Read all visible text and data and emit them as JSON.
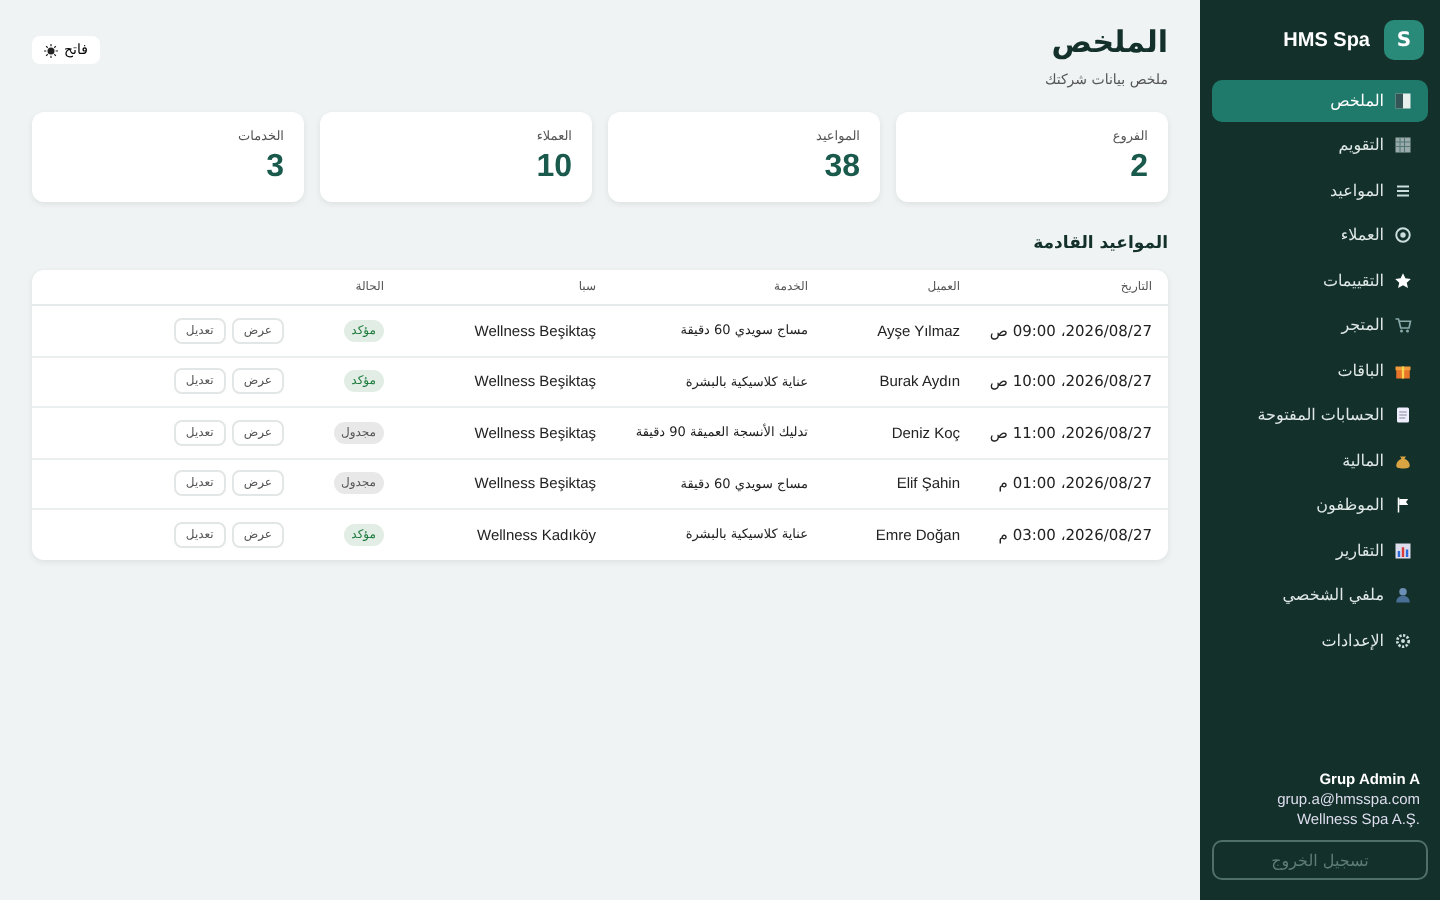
{
  "sidebar": {
    "brand": "HMS Spa",
    "logo_letter": "S",
    "items": [
      {
        "label": "الملخص",
        "selected": true
      },
      {
        "label": "التقويم",
        "selected": false
      },
      {
        "label": "المواعيد",
        "selected": false
      },
      {
        "label": "العملاء",
        "selected": false
      },
      {
        "label": "التقييمات",
        "selected": false
      },
      {
        "label": "المتجر",
        "selected": false
      },
      {
        "label": "الباقات",
        "selected": false
      },
      {
        "label": "الحسابات المفتوحة",
        "selected": false
      },
      {
        "label": "المالية",
        "selected": false
      },
      {
        "label": "الموظفون",
        "selected": false
      },
      {
        "label": "التقارير",
        "selected": false
      },
      {
        "label": "ملفي الشخصي",
        "selected": false
      },
      {
        "label": "الإعدادات",
        "selected": false
      }
    ],
    "user": {
      "name": "Grup Admin A",
      "email": "grup.a@hmsspa.com",
      "company": "Wellness Spa A.Ş."
    },
    "logout": "تسجيل الخروج"
  },
  "header": {
    "title": "الملخص",
    "subtitle": "ملخص بيانات شركتك",
    "theme_button": "فاتح"
  },
  "stats": [
    {
      "label": "الفروع",
      "value": "2"
    },
    {
      "label": "المواعيد",
      "value": "38"
    },
    {
      "label": "العملاء",
      "value": "10"
    },
    {
      "label": "الخدمات",
      "value": "3"
    }
  ],
  "appointments": {
    "title": "المواعيد القادمة",
    "columns": [
      "التاريخ",
      "العميل",
      "الخدمة",
      "سبا",
      "الحالة"
    ],
    "rows": [
      {
        "date": "2026/08/27، 09:00 ص",
        "client": "Ayşe Yılmaz",
        "service": "مساج سويدي 60 دقيقة",
        "spa": "Wellness Beşiktaş",
        "status": {
          "label": "مؤكد",
          "color": "#1c7a3c"
        },
        "actions": [
          "عرض",
          "تعديل"
        ]
      },
      {
        "date": "2026/08/27، 10:00 ص",
        "client": "Burak Aydın",
        "service": "عناية كلاسيكية بالبشرة",
        "spa": "Wellness Beşiktaş",
        "status": {
          "label": "مؤكد",
          "color": "#1c7a3c"
        },
        "actions": [
          "عرض",
          "تعديل"
        ]
      },
      {
        "date": "2026/08/27، 11:00 ص",
        "client": "Deniz Koç",
        "service": "تدليك الأنسجة العميقة 90 دقيقة",
        "spa": "Wellness Beşiktaş",
        "status": {
          "label": "مجدول",
          "color": "#555555"
        },
        "actions": [
          "عرض",
          "تعديل"
        ]
      },
      {
        "date": "2026/08/27، 01:00 م",
        "client": "Elif Şahin",
        "service": "مساج سويدي 60 دقيقة",
        "spa": "Wellness Beşiktaş",
        "status": {
          "label": "مجدول",
          "color": "#555555"
        },
        "actions": [
          "عرض",
          "تعديل"
        ]
      },
      {
        "date": "2026/08/27، 03:00 م",
        "client": "Emre Doğan",
        "service": "عناية كلاسيكية بالبشرة",
        "spa": "Wellness Kadıköy",
        "status": {
          "label": "مؤكد",
          "color": "#1c7a3c"
        },
        "actions": [
          "عرض",
          "تعديل"
        ]
      }
    ]
  }
}
